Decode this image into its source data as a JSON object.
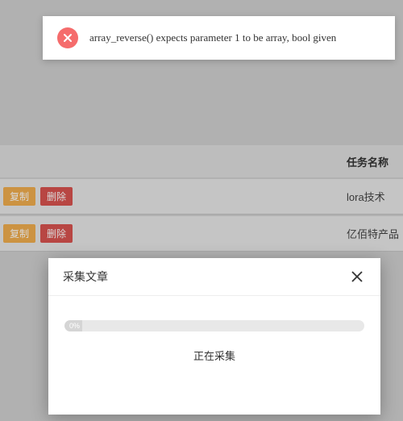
{
  "toast": {
    "message": "array_reverse() expects parameter 1 to be array, bool given"
  },
  "table": {
    "header": {
      "name": "任务名称"
    },
    "rows": [
      {
        "copy_label": "复制",
        "delete_label": "删除",
        "name": "lora技术"
      },
      {
        "copy_label": "复制",
        "delete_label": "删除",
        "name": "亿佰特产品"
      }
    ]
  },
  "modal": {
    "title": "采集文章",
    "progress_text": "0%",
    "status": "正在采集"
  }
}
